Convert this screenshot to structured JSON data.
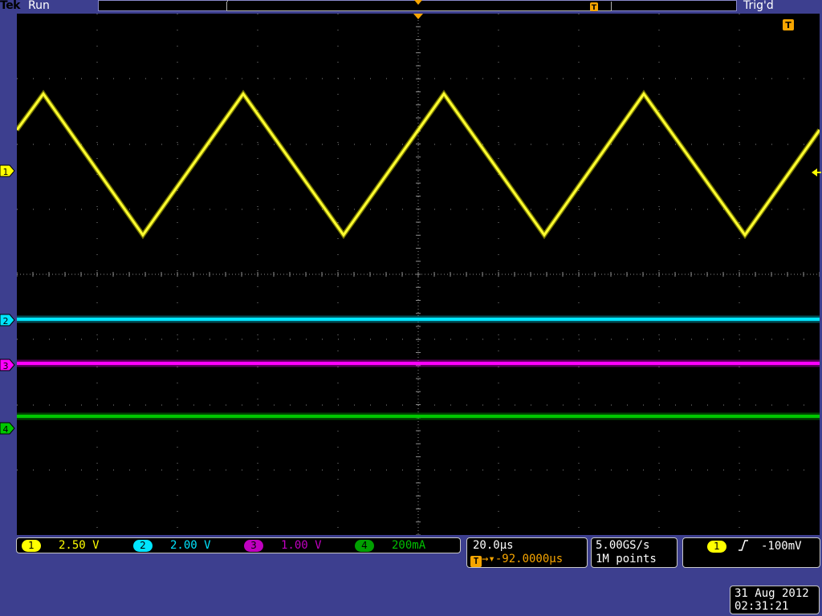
{
  "header": {
    "brand": "Tek",
    "run_state": "Run",
    "trigger_state": "Trig'd"
  },
  "channels": [
    {
      "id": "1",
      "scale": "2.50 V",
      "color": "#ffff00"
    },
    {
      "id": "2",
      "scale": "2.00 V",
      "color": "#00e5ff"
    },
    {
      "id": "3",
      "scale": "1.00 V",
      "color": "#ff00ff"
    },
    {
      "id": "4",
      "scale": "200mA",
      "color": "#00c800"
    }
  ],
  "horizontal": {
    "scale": "20.0µs",
    "position": "→▾-92.0000µs",
    "trigger_badge": "T"
  },
  "acquisition": {
    "sample_rate": "5.00GS/s",
    "record_length": "1M points"
  },
  "trigger": {
    "source": "1",
    "slope": "rising-edge-icon",
    "level": "-100mV"
  },
  "datetime": {
    "date": "31 Aug 2012",
    "time": "02:31:21"
  },
  "colors": {
    "background": "#3d3f8f",
    "graticule": "#000000",
    "trigger_marker": "#f7a500"
  }
}
